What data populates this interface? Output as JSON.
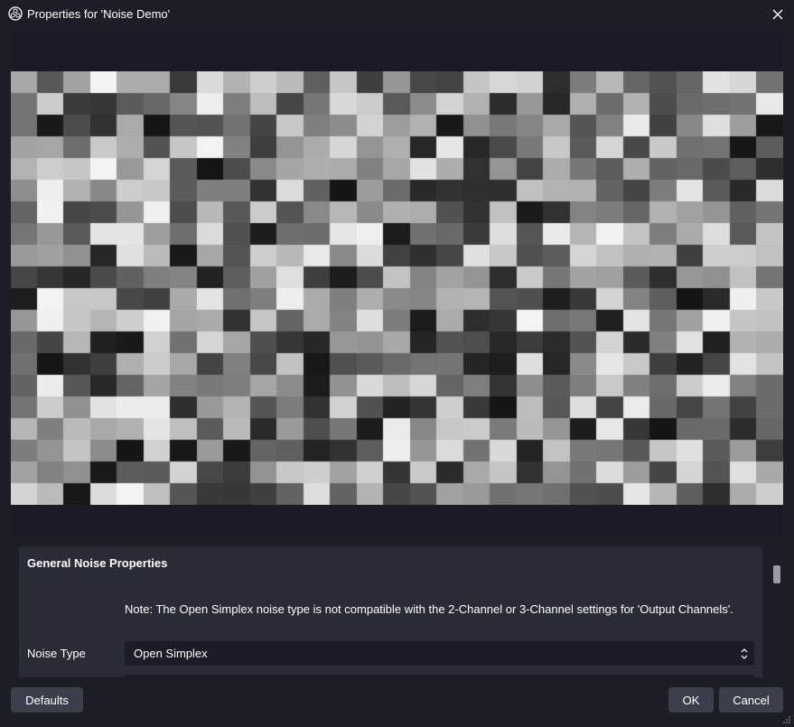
{
  "window": {
    "title": "Properties for 'Noise Demo'",
    "app_icon": "obs-logo-icon",
    "close_icon": "close-icon"
  },
  "preview": {
    "kind": "grayscale-noise-grid",
    "columns": 29,
    "rows": 20
  },
  "properties": {
    "group_title": "General Noise Properties",
    "note": "Note: The Open Simplex noise type is not compatible with the 2-Channel or 3-Channel settings for 'Output Channels'.",
    "noise_type": {
      "label": "Noise Type",
      "value": "Open Simplex"
    }
  },
  "buttons": {
    "defaults": "Defaults",
    "ok": "OK",
    "cancel": "Cancel"
  },
  "colors": {
    "window_bg": "#1c1d26",
    "preview_bg": "#181a26",
    "panel_bg": "#292b36",
    "input_bg": "#1b1c28",
    "button_bg": "#3b3e4b"
  }
}
